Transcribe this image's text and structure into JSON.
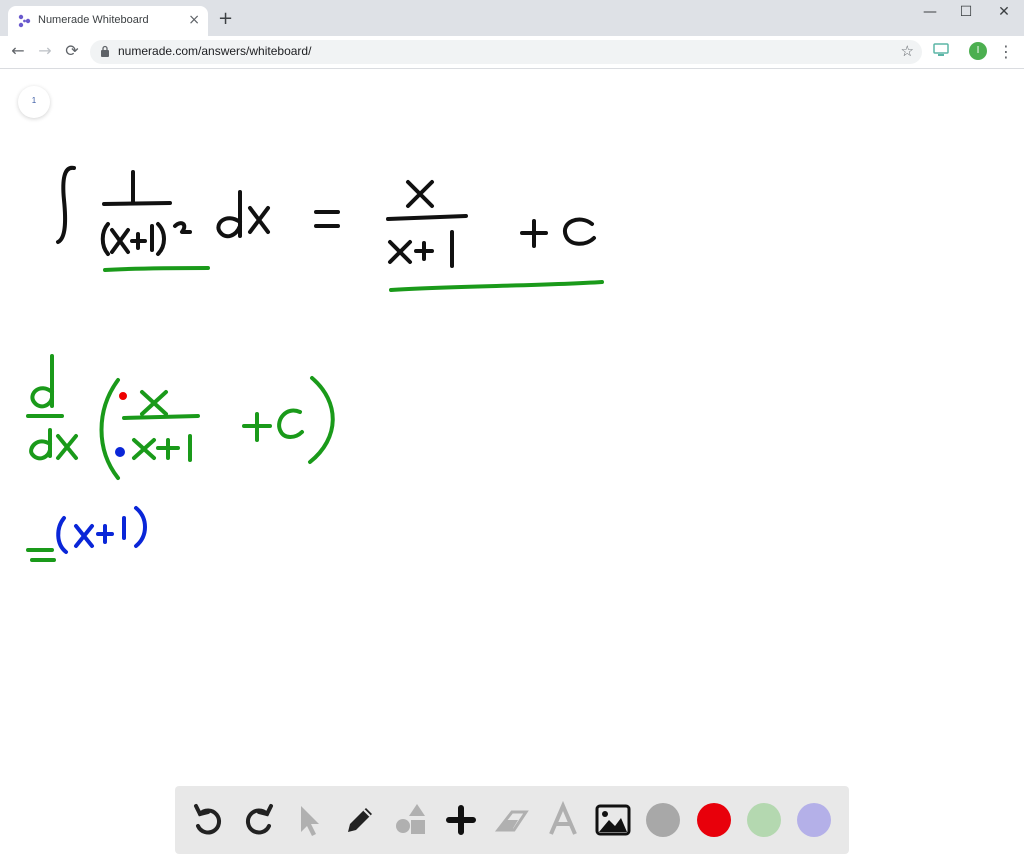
{
  "browser": {
    "tab_title": "Numerade Whiteboard",
    "tab_close": "×",
    "new_tab": "+",
    "url": "numerade.com/answers/whiteboard/",
    "profile_initial": "I",
    "window_controls": {
      "minimize": "—",
      "maximize": "☐",
      "close": "✕"
    },
    "nav": {
      "back": "←",
      "forward": "→",
      "reload": "⟳"
    },
    "star": "☆",
    "menu": "⋮"
  },
  "whiteboard": {
    "page_number": "1",
    "handwriting": {
      "integral_expression": "∫ 1/(x+1)² dx = x/(x+1) + C",
      "derivative_expression": "d/dx ( x/(x+1) + C )",
      "partial_step": "= (x+1)"
    }
  },
  "toolbar": {
    "tools": [
      "undo-icon",
      "redo-icon",
      "select-icon",
      "pen-icon",
      "shapes-icon",
      "add-icon",
      "eraser-icon",
      "text-icon",
      "image-icon"
    ],
    "colors": [
      "#a8a8a8",
      "#e8000b",
      "#b4d8b0",
      "#b4b0e8"
    ]
  }
}
